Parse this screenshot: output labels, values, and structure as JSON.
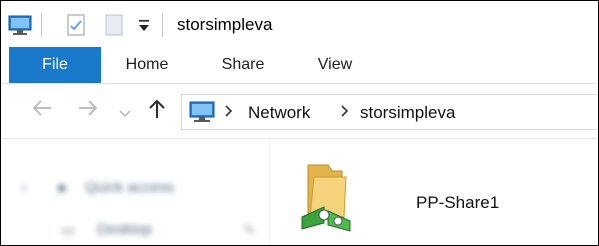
{
  "title_bar": {
    "window_title": "storsimpleva",
    "icons": [
      "computer-icon",
      "properties-icon",
      "new-folder-icon",
      "customize-toolbar-icon"
    ]
  },
  "ribbon": {
    "tabs": [
      {
        "label": "File",
        "active": true
      },
      {
        "label": "Home",
        "active": false
      },
      {
        "label": "Share",
        "active": false
      },
      {
        "label": "View",
        "active": false
      }
    ],
    "file_tab_color": "#1979ca"
  },
  "navigation": {
    "back_icon": "back-arrow-icon",
    "forward_icon": "forward-arrow-icon",
    "recent_icon": "chevron-down-icon",
    "up_icon": "up-arrow-icon"
  },
  "address_bar": {
    "location_icon": "network-computer-icon",
    "breadcrumbs": [
      "Network",
      "storsimpleva"
    ]
  },
  "nav_pane": {
    "items": [
      {
        "label": "Quick access",
        "icon": "star-icon"
      },
      {
        "label": "Desktop",
        "icon": "desktop-icon",
        "pin": "pin-icon"
      }
    ]
  },
  "content": {
    "items": [
      {
        "name": "PP-Share1",
        "icon": "network-share-folder-icon"
      }
    ]
  }
}
